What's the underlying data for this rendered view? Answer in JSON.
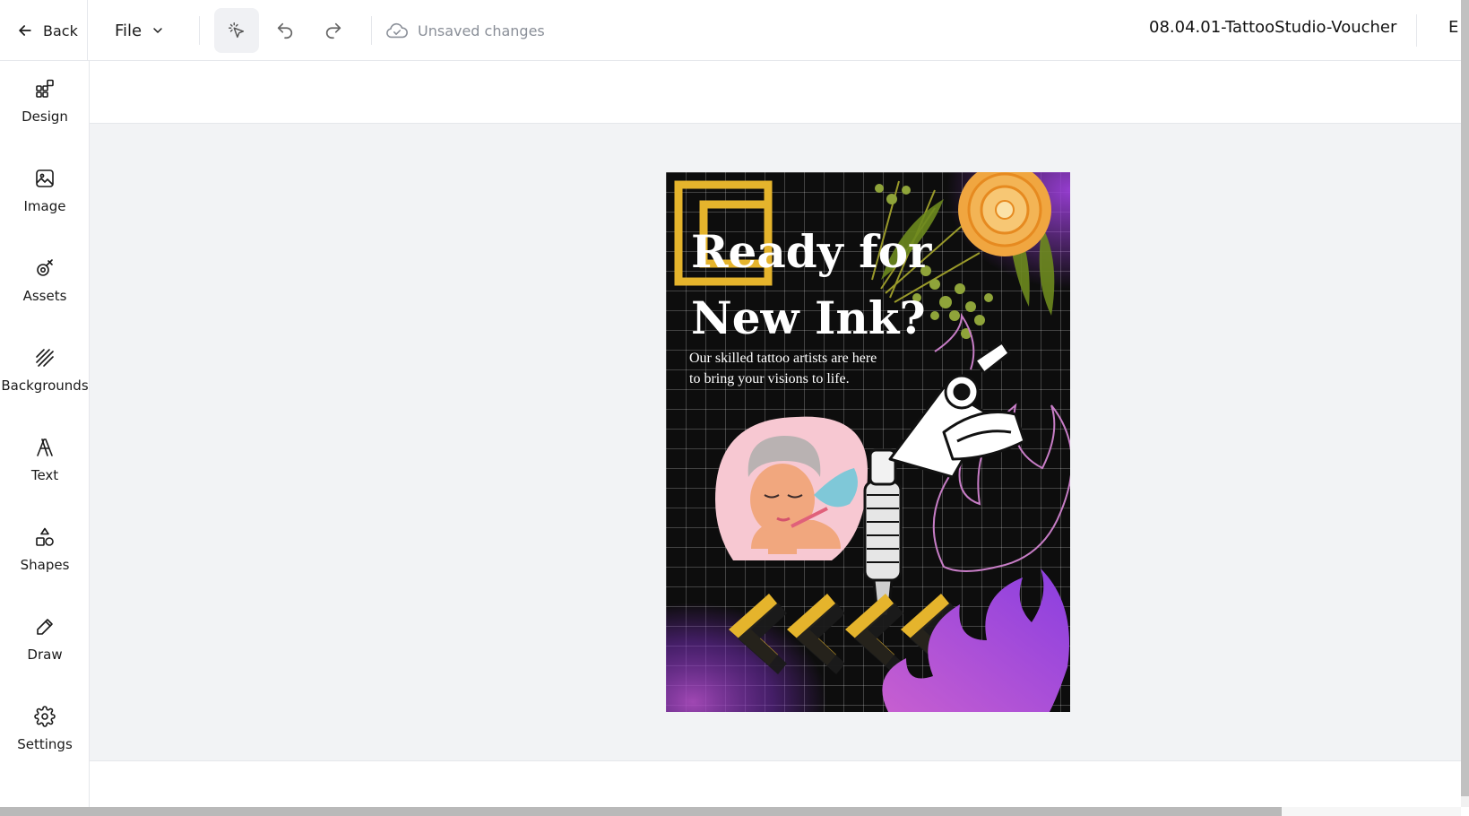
{
  "toolbar": {
    "back_label": "Back",
    "file_label": "File",
    "save_status": "Unsaved changes",
    "document_title": "08.04.01-TattooStudio-Voucher",
    "export_label_partial": "E"
  },
  "sidebar": {
    "items": [
      {
        "label": "Design",
        "icon": "design-icon"
      },
      {
        "label": "Image",
        "icon": "image-icon"
      },
      {
        "label": "Assets",
        "icon": "assets-icon"
      },
      {
        "label": "Backgrounds",
        "icon": "backgrounds-icon"
      },
      {
        "label": "Text",
        "icon": "text-icon"
      },
      {
        "label": "Shapes",
        "icon": "shapes-icon"
      },
      {
        "label": "Draw",
        "icon": "draw-icon"
      },
      {
        "label": "Settings",
        "icon": "settings-icon"
      }
    ]
  },
  "poster": {
    "title_line1": "Ready for",
    "title_line2": "New Ink?",
    "body": "Our skilled tattoo artists are here to bring your visions to life."
  },
  "colors": {
    "accent_yellow": "#e5b42c",
    "accent_purple": "#9b3fd8",
    "flower_orange": "#f0a640",
    "skin": "#f1a77e",
    "workspace_bg": "#f2f3f5"
  }
}
